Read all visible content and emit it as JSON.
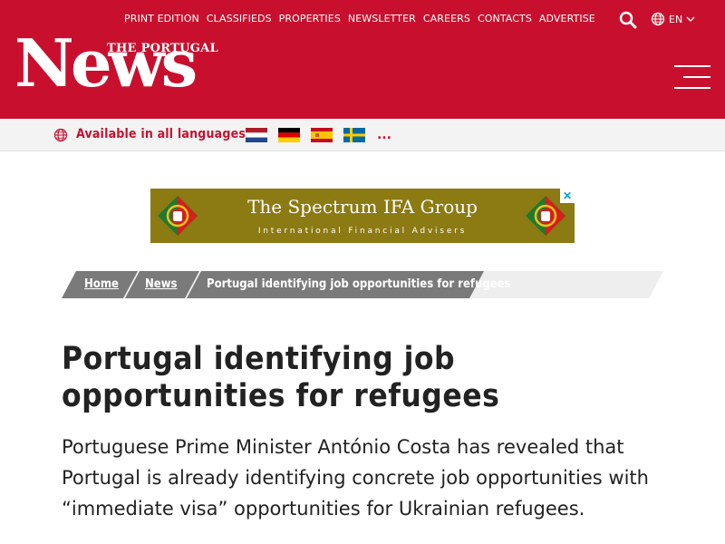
{
  "header": {
    "nav": [
      "PRINT EDITION",
      "CLASSIFIEDS",
      "PROPERTIES",
      "NEWSLETTER",
      "CAREERS",
      "CONTACTS",
      "ADVERTISE"
    ],
    "language": "EN",
    "logo_small": "THE PORTUGAL",
    "logo_big": "News",
    "icons": {
      "search": "search-icon",
      "globe": "globe-icon",
      "menu": "hamburger-menu-icon",
      "caret": "chevron-down-icon"
    }
  },
  "language_bar": {
    "label": "Available in all languages",
    "more": "...",
    "flags": [
      "netherlands-flag",
      "germany-flag",
      "spain-flag",
      "sweden-flag"
    ]
  },
  "ad": {
    "line1": "The Spectrum IFA Group",
    "line2": "International Financial Advisers",
    "close": "✕"
  },
  "breadcrumb": [
    "Home",
    "News",
    "Portugal identifying job opportunities for refugees"
  ],
  "article": {
    "title": "Portugal identifying job opportunities for refugees",
    "lead": "Portuguese Prime Minister António Costa has revealed that Portugal is already identifying concrete job opportunities with “immediate visa” opportunities for Ukrainian refugees."
  },
  "colors": {
    "brand": "#c8102e",
    "ad_background": "#8c7a12",
    "crumb_background": "#7a7a7a"
  }
}
